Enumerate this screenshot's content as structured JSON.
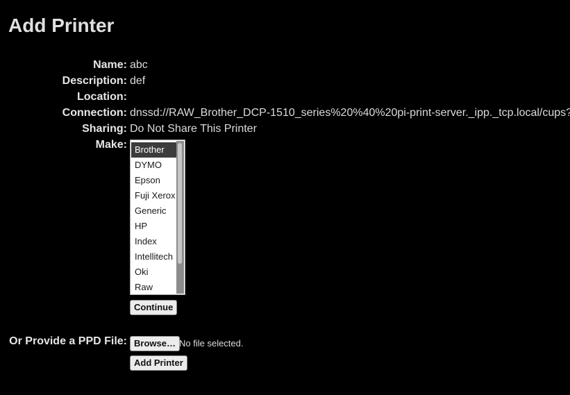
{
  "page": {
    "title": "Add Printer"
  },
  "form": {
    "name": {
      "label": "Name:",
      "value": "abc"
    },
    "description": {
      "label": "Description:",
      "value": "def"
    },
    "location": {
      "label": "Location:",
      "value": ""
    },
    "connection": {
      "label": "Connection:",
      "value": "dnssd://RAW_Brother_DCP-1510_series%20%40%20pi-print-server._ipp._tcp.local/cups?"
    },
    "sharing": {
      "label": "Sharing:",
      "value": "Do Not Share This Printer"
    },
    "make": {
      "label": "Make:",
      "selected": "Brother",
      "options": [
        "Brother",
        "DYMO",
        "Epson",
        "Fuji Xerox",
        "Generic",
        "HP",
        "Index",
        "Intellitech",
        "Oki",
        "Raw"
      ]
    },
    "continue_label": "Continue"
  },
  "ppd": {
    "label": "Or Provide a PPD File:",
    "browse_label": "Browse…",
    "file_status": "No file selected.",
    "add_printer_label": "Add Printer"
  }
}
